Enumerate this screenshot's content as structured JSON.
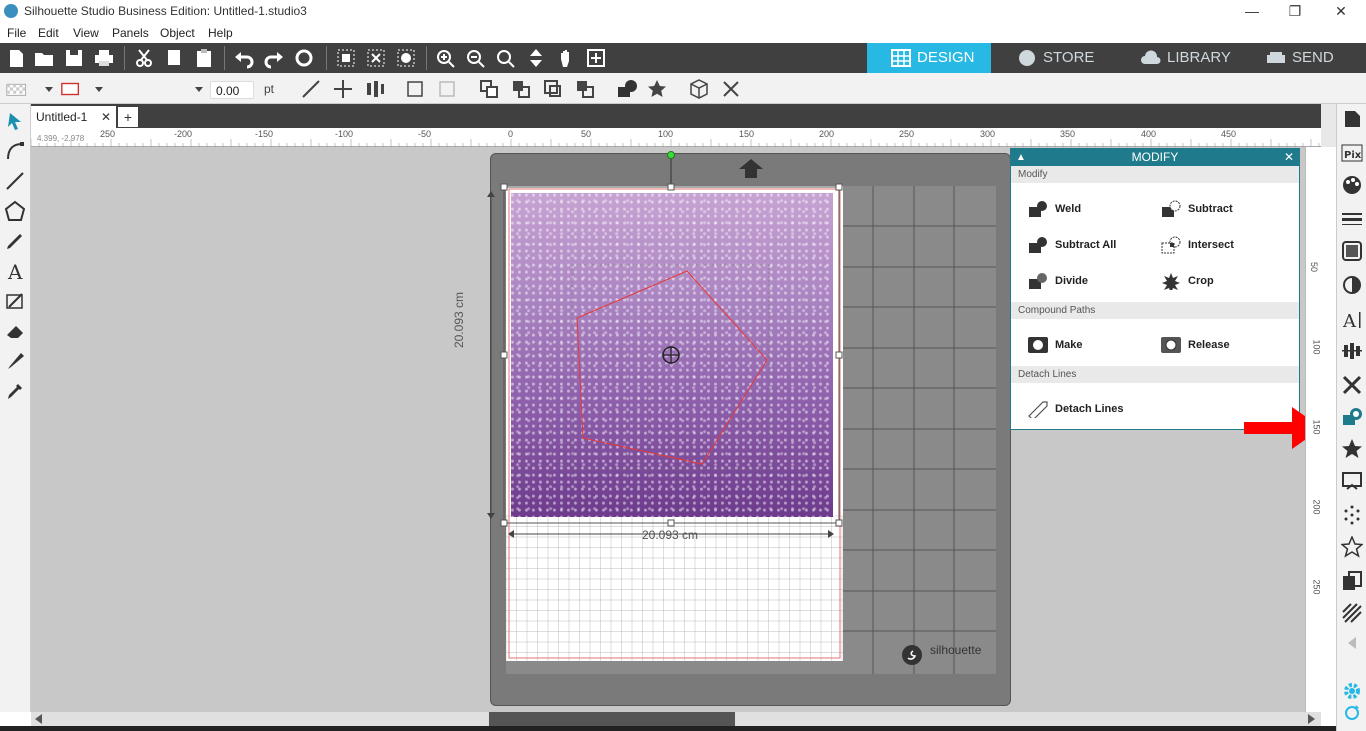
{
  "window": {
    "title": "Silhouette Studio Business Edition: Untitled-1.studio3",
    "minimize": "—",
    "restore": "❐",
    "close": "✕"
  },
  "menu": [
    "File",
    "Edit",
    "View",
    "Panels",
    "Object",
    "Help"
  ],
  "nav_tabs": [
    {
      "label": "DESIGN",
      "active": true
    },
    {
      "label": "STORE",
      "active": false
    },
    {
      "label": "LIBRARY",
      "active": false
    },
    {
      "label": "SEND",
      "active": false
    }
  ],
  "toolbar2": {
    "line_width_value": "0.00",
    "line_width_unit": "pt"
  },
  "document_tab": {
    "name": "Untitled-1",
    "close": "✕",
    "add": "+"
  },
  "ruler": {
    "coords": "4.399, -2.978",
    "h_labels": [
      "250",
      "-200",
      "-150",
      "-100",
      "-50",
      "0",
      "50",
      "100",
      "150",
      "200",
      "250",
      "300",
      "350",
      "400",
      "450"
    ],
    "v_labels": [
      "50",
      "100",
      "150",
      "200",
      "250"
    ]
  },
  "canvas": {
    "width_dim": "20.093 cm",
    "height_dim": "20.093 cm",
    "brand": "silhouette"
  },
  "modify_panel": {
    "title": "MODIFY",
    "sections": {
      "modify": "Modify",
      "compound": "Compound Paths",
      "detach": "Detach Lines"
    },
    "items": {
      "weld": "Weld",
      "subtract": "Subtract",
      "subtract_all": "Subtract All",
      "intersect": "Intersect",
      "divide": "Divide",
      "crop": "Crop",
      "make": "Make",
      "release": "Release",
      "detach_lines": "Detach Lines"
    }
  },
  "colors": {
    "accent": "#27b9e4",
    "panel_header": "#1f7a8c",
    "dark_toolbar": "#404040",
    "arrow": "#ff0000",
    "pentagon_stroke": "#e53935"
  }
}
